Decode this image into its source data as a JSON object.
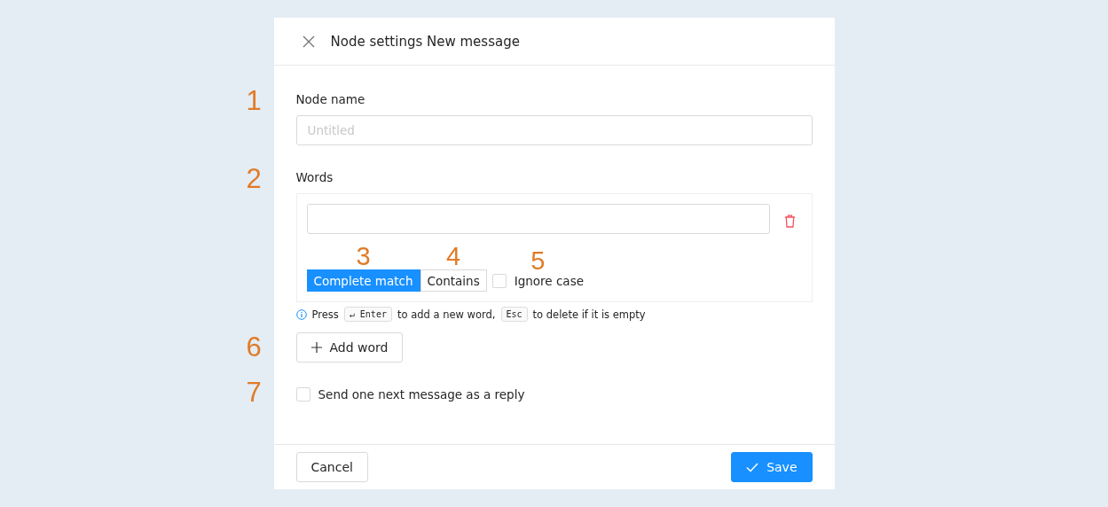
{
  "dialog": {
    "title": "Node settings New message"
  },
  "node_name": {
    "marker": "1",
    "label": "Node name",
    "placeholder": "Untitled"
  },
  "words": {
    "marker": "2",
    "label": "Words",
    "entries": [
      {
        "match_modes": [
          {
            "marker": "3",
            "label": "Complete match",
            "selected": true
          },
          {
            "marker": "4",
            "label": "Contains",
            "selected": false
          }
        ],
        "ignore_case": {
          "marker": "5",
          "label": "Ignore case",
          "checked": false
        }
      }
    ],
    "hint": [
      {
        "kind": "text",
        "text": "Press"
      },
      {
        "kind": "key",
        "text": "↵ Enter"
      },
      {
        "kind": "text",
        "text": "to add a new word,"
      },
      {
        "kind": "key",
        "text": "Esc"
      },
      {
        "kind": "text",
        "text": "to delete if it is empty"
      }
    ],
    "add_button": {
      "marker": "6",
      "label": "Add word"
    }
  },
  "reply_option": {
    "marker": "7",
    "label": "Send one next message as a reply",
    "checked": false
  },
  "footer": {
    "cancel": "Cancel",
    "save": "Save"
  }
}
